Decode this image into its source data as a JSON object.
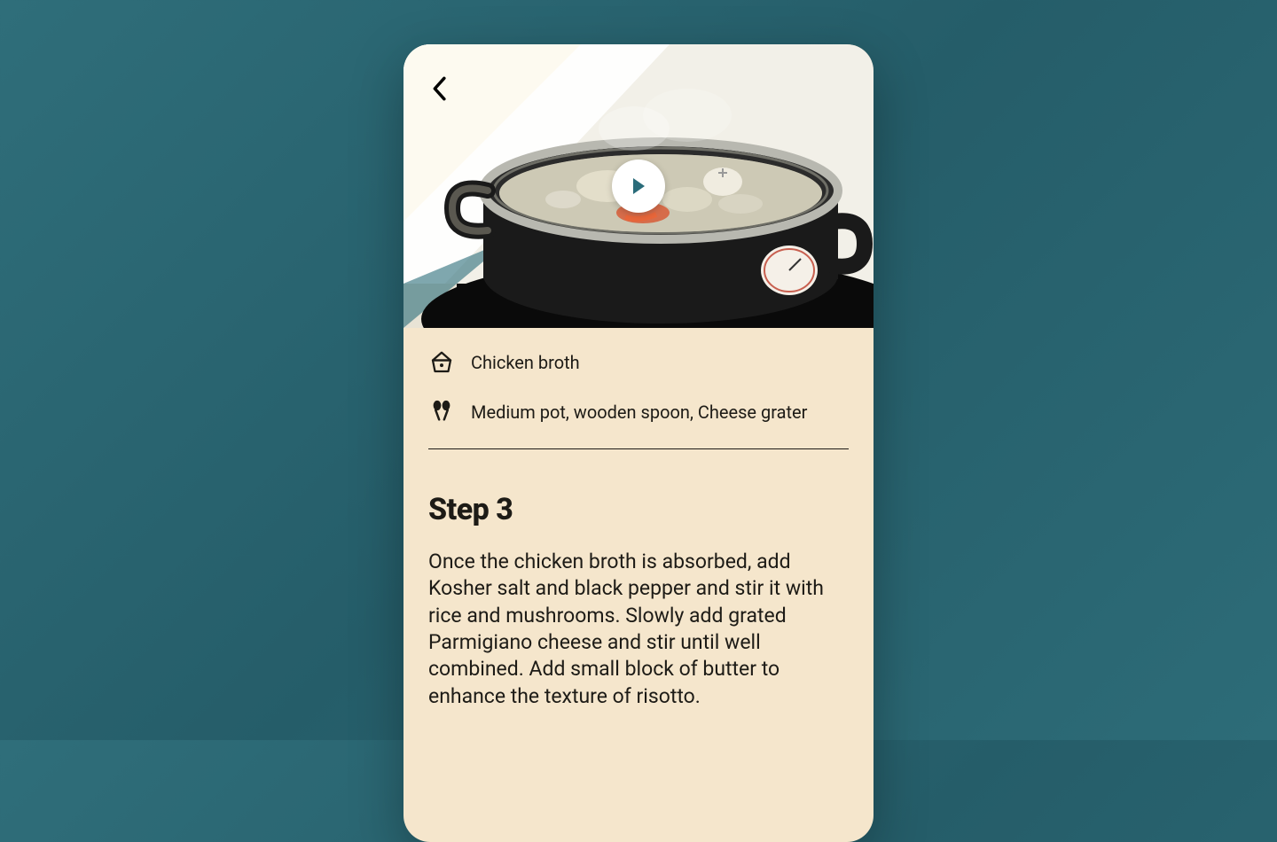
{
  "info": {
    "ingredient": "Chicken broth",
    "tools": "Medium pot, wooden spoon, Cheese grater"
  },
  "step": {
    "title": "Step 3",
    "body": "Once the chicken broth is absorbed, add Kosher salt and black pepper and stir it with rice and mushrooms. Slowly add grated Parmigiano cheese and stir until well combined. Add small block of butter to enhance the texture of risotto."
  },
  "colors": {
    "accent": "#2a6c7a",
    "card": "#f5e6cc",
    "ink": "#1d1b16"
  }
}
